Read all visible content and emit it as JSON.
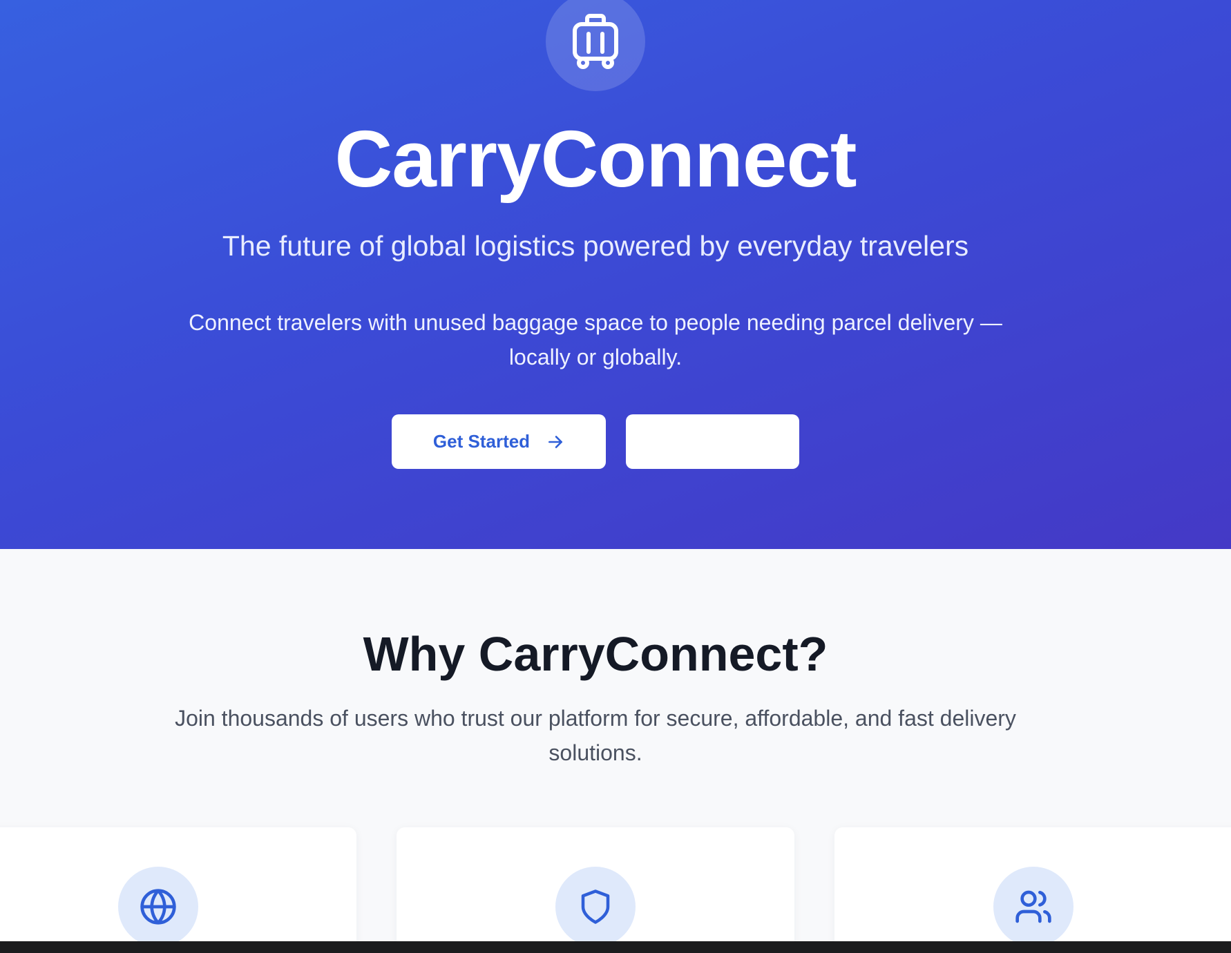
{
  "hero": {
    "logo_icon": "luggage-icon",
    "title": "CarryConnect",
    "subtitle": "The future of global logistics powered by everyday travelers",
    "description": "Connect travelers with unused baggage space to people needing parcel delivery — locally or globally.",
    "primary_button_label": "Get Started",
    "primary_button_icon": "arrow-right-icon",
    "secondary_button_label": ""
  },
  "features": {
    "title": "Why CarryConnect?",
    "description": "Join thousands of users who trust our platform for secure, affordable, and fast delivery solutions.",
    "cards": [
      {
        "icon": "globe-icon"
      },
      {
        "icon": "shield-icon"
      },
      {
        "icon": "users-icon"
      }
    ]
  },
  "colors": {
    "hero_gradient_start": "#3760e0",
    "hero_gradient_end": "#4439c6",
    "accent": "#2f5fd8",
    "icon_circle_bg": "#dfe9fb",
    "page_bg": "#f8f9fb",
    "heading_text": "#151a26"
  }
}
